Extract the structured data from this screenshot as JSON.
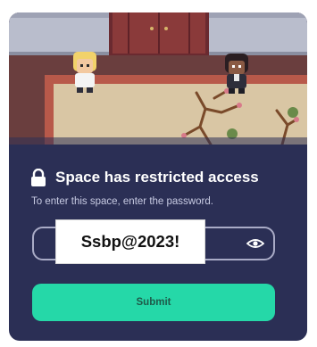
{
  "dialog": {
    "title": "Space has restricted access",
    "subtitle": "To enter this space, enter the password.",
    "password_value": "Ssbp@2023!",
    "submit_label": "Submit",
    "lock_icon": "lock-icon",
    "visibility_icon": "eye-icon"
  },
  "colors": {
    "dialog_background": "#2b2f55",
    "accent": "#25d8a8",
    "text_primary": "#ffffff",
    "text_secondary": "#c8cbe3"
  }
}
